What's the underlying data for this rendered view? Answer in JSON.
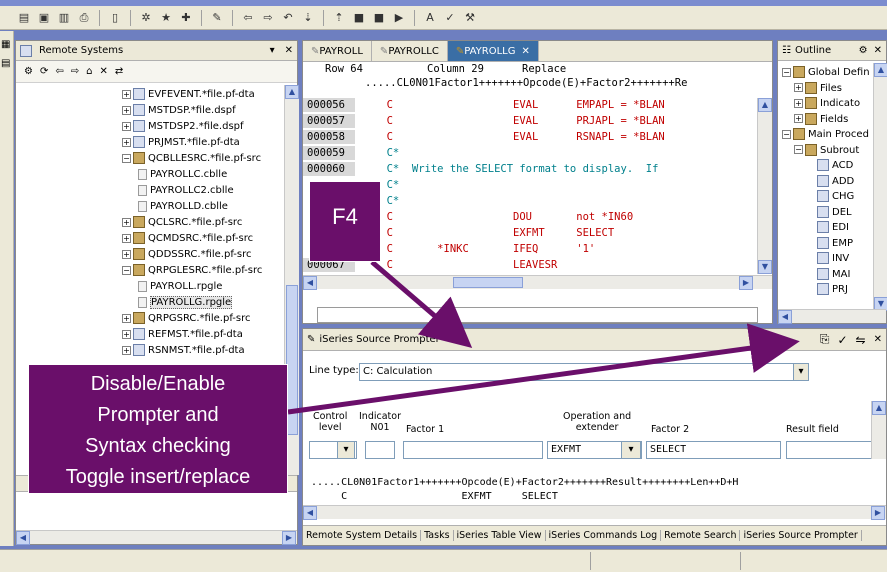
{
  "toolbar": {
    "icons": [
      "new-icon",
      "save-icon",
      "save-all-icon",
      "print-icon",
      "open-member-icon",
      "debug-icon",
      "run-icon",
      "external-tools-icon",
      "pin-icon",
      "back-icon",
      "forward-icon",
      "last-edit-icon",
      "next-annotation-icon",
      "prev-annotation-icon",
      "stop-icon",
      "suspend-icon",
      "resume-icon",
      "font-icon",
      "verify-icon",
      "compile-icon"
    ]
  },
  "remote_systems": {
    "title": "Remote Systems",
    "tree": [
      {
        "label": "EVFEVENT.*file.pf-dta",
        "icon": "file"
      },
      {
        "label": "MSTDSP.*file.dspf",
        "icon": "file"
      },
      {
        "label": "MSTDSP2.*file.dspf",
        "icon": "file"
      },
      {
        "label": "PRJMST.*file.pf-dta",
        "icon": "file"
      },
      {
        "label": "QCBLLESRC.*file.pf-src",
        "icon": "src",
        "expanded": true
      },
      {
        "label": "PAYROLLC.cblle",
        "icon": "mbr"
      },
      {
        "label": "PAYROLLC2.cblle",
        "icon": "mbr"
      },
      {
        "label": "PAYROLLD.cblle",
        "icon": "mbr"
      },
      {
        "label": "QCLSRC.*file.pf-src",
        "icon": "src"
      },
      {
        "label": "QCMDSRC.*file.pf-src",
        "icon": "src"
      },
      {
        "label": "QDDSSRC.*file.pf-src",
        "icon": "src"
      },
      {
        "label": "QRPGLESRC.*file.pf-src",
        "icon": "src",
        "expanded": true
      },
      {
        "label": "PAYROLL.rpgle",
        "icon": "mbr"
      },
      {
        "label": "PAYROLLG.rpgle",
        "icon": "mbr",
        "selected": true
      },
      {
        "label": "QRPGSRC.*file.pf-src",
        "icon": "src"
      },
      {
        "label": "REFMST.*file.pf-dta",
        "icon": "file"
      },
      {
        "label": "RSNMST.*file.pf-dta",
        "icon": "file"
      }
    ]
  },
  "editor": {
    "tabs": [
      {
        "label": "PAYROLL"
      },
      {
        "label": "PAYROLLC"
      },
      {
        "label": "PAYROLLG",
        "active": true
      }
    ],
    "status": {
      "row": "Row 64",
      "column": "Column 29",
      "mode": "Replace"
    },
    "ruler": ".....CL0N01Factor1+++++++Opcode(E)+Factor2+++++++Re",
    "lines": [
      {
        "seq": "000056",
        "text": "     C                   EVAL      EMPAPL = *BLAN"
      },
      {
        "seq": "000057",
        "text": "     C                   EVAL      PRJAPL = *BLAN"
      },
      {
        "seq": "000058",
        "text": "     C                   EVAL      RSNAPL = *BLAN"
      },
      {
        "seq": "000059",
        "text": "     C*"
      },
      {
        "seq": "000060",
        "text": "     C*  Write the SELECT format to display.  If"
      },
      {
        "seq": "",
        "text": "     C*"
      },
      {
        "seq": "",
        "text": "     C*"
      },
      {
        "seq": "",
        "text": "     C                   DOU       not *IN60"
      },
      {
        "seq": "",
        "text": "     C                   EXFMT     SELECT"
      },
      {
        "seq": "",
        "text": "     C       *INKC       IFEQ      '1'"
      },
      {
        "seq": "000067",
        "text": "     C                   LEAVESR"
      }
    ]
  },
  "outline": {
    "title": "Outline",
    "items": [
      {
        "label": "Global Defin",
        "depth": 0
      },
      {
        "label": "Files",
        "depth": 1
      },
      {
        "label": "Indicato",
        "depth": 1
      },
      {
        "label": "Fields",
        "depth": 1
      },
      {
        "label": "Main Proced",
        "depth": 0
      },
      {
        "label": "Subrout",
        "depth": 1
      },
      {
        "label": "ACD",
        "depth": 2
      },
      {
        "label": "ADD",
        "depth": 2
      },
      {
        "label": "CHG",
        "depth": 2
      },
      {
        "label": "DEL",
        "depth": 2
      },
      {
        "label": "EDI",
        "depth": 2
      },
      {
        "label": "EMP",
        "depth": 2
      },
      {
        "label": "INV",
        "depth": 2
      },
      {
        "label": "MAI",
        "depth": 2
      },
      {
        "label": "PRJ",
        "depth": 2
      }
    ]
  },
  "prompter": {
    "title": "iSeries Source Prompter",
    "line_type_label": "Line type:",
    "line_type_value": "C: Calculation",
    "headers": {
      "control_level": "Control\nlevel",
      "indicator": "Indicator\nN01",
      "factor1": "Factor 1",
      "operation": "Operation and\nextender",
      "factor2": "Factor 2",
      "result": "Result field"
    },
    "operation_value": "EXFMT",
    "factor2_value": "SELECT",
    "ruler": ".....CL0N01Factor1+++++++Opcode(E)+Factor2+++++++Result++++++++Len++D+H",
    "preview": "     C                   EXFMT     SELECT"
  },
  "bottom_tabs": [
    "Remote System Details",
    "Tasks",
    "iSeries Table View",
    "iSeries Commands Log",
    "Remote Search",
    "iSeries Source Prompter"
  ],
  "callouts": {
    "f4": "F4",
    "toggle": [
      "Disable/Enable",
      "Prompter and",
      "Syntax checking",
      "Toggle insert/replace"
    ]
  },
  "colors": {
    "callout_bg": "#6a0f6a",
    "background": "#6e7fc0",
    "keyword": "#c00000",
    "comment": "#00808c"
  }
}
